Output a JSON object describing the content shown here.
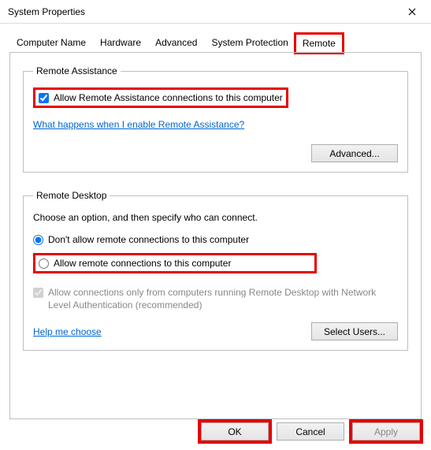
{
  "window": {
    "title": "System Properties"
  },
  "tabs": {
    "t0": "Computer Name",
    "t1": "Hardware",
    "t2": "Advanced",
    "t3": "System Protection",
    "t4": "Remote"
  },
  "assist": {
    "legend": "Remote Assistance",
    "allow": "Allow Remote Assistance connections to this computer",
    "link": "What happens when I enable Remote Assistance?",
    "advanced": "Advanced..."
  },
  "desktop": {
    "legend": "Remote Desktop",
    "intro": "Choose an option, and then specify who can connect.",
    "opt_deny": "Don't allow remote connections to this computer",
    "opt_allow": "Allow remote connections to this computer",
    "nla": "Allow connections only from computers running Remote Desktop with Network Level Authentication (recommended)",
    "help": "Help me choose",
    "select_users": "Select Users..."
  },
  "buttons": {
    "ok": "OK",
    "cancel": "Cancel",
    "apply": "Apply"
  }
}
